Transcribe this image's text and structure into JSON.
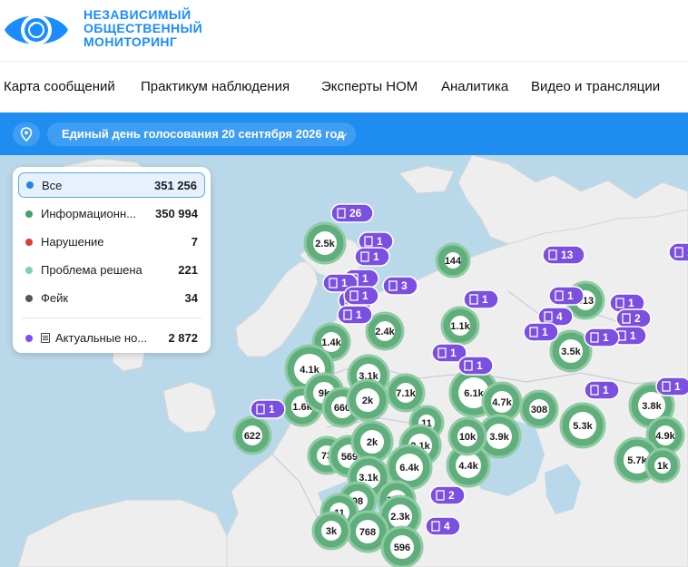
{
  "brand": {
    "line1": "НЕЗАВИСИМЫЙ",
    "line2": "ОБЩЕСТВЕННЫЙ",
    "line3": "МОНИТОРИНГ",
    "logo_icon": "eye-logo"
  },
  "nav": [
    {
      "label": "Карта сообщений"
    },
    {
      "label": "Практикум наблюдения"
    },
    {
      "label": "Эксперты НОМ"
    },
    {
      "label": "Аналитика"
    },
    {
      "label": "Видео и трансляции"
    }
  ],
  "filter": {
    "location_icon": "location-pin-icon",
    "election": "Единый день голосования 20 сентября 2026 год",
    "chevron_icon": "chevron-down-icon"
  },
  "legend": [
    {
      "label": "Все",
      "count": "351 256",
      "color": "#1e88e5",
      "active": true
    },
    {
      "label": "Информационн...",
      "count": "350 994",
      "color": "#43a36b"
    },
    {
      "label": "Нарушение",
      "count": "7",
      "color": "#e53935"
    },
    {
      "label": "Проблема решена",
      "count": "221",
      "color": "#7dd3b0"
    },
    {
      "label": "Фейк",
      "count": "34",
      "color": "#555555"
    },
    {
      "label": "Актуальные но...",
      "count": "2 872",
      "color": "#7c4dff",
      "doc": true
    }
  ],
  "colors": {
    "cluster_green": "#5fae7c",
    "cluster_ring": "#8fcaa3",
    "pill_purple": "#7b4fe0",
    "brand_blue": "#1a8cff",
    "bar_blue": "#1f8cf0"
  },
  "clusters": [
    {
      "label": "2.5k"
    },
    {
      "label": "144"
    },
    {
      "label": "913"
    },
    {
      "label": "1.4k"
    },
    {
      "label": "2.4k"
    },
    {
      "label": "1.1k"
    },
    {
      "label": "3.5k"
    },
    {
      "label": "4.1k"
    },
    {
      "label": "3.1k"
    },
    {
      "label": "1.6k"
    },
    {
      "label": "9k"
    },
    {
      "label": "660"
    },
    {
      "label": "2k"
    },
    {
      "label": "7.1k"
    },
    {
      "label": "6.1k"
    },
    {
      "label": "4.7k"
    },
    {
      "label": "308"
    },
    {
      "label": "5.3k"
    },
    {
      "label": "3.8k"
    },
    {
      "label": "622"
    },
    {
      "label": "11"
    },
    {
      "label": "2.1k"
    },
    {
      "label": "3.9k"
    },
    {
      "label": "4.9k"
    },
    {
      "label": "73"
    },
    {
      "label": "569"
    },
    {
      "label": "2k"
    },
    {
      "label": "3.1k"
    },
    {
      "label": "4.4k"
    },
    {
      "label": "6.4k"
    },
    {
      "label": "10k"
    },
    {
      "label": "5.7k"
    },
    {
      "label": "1k"
    },
    {
      "label": "3.6k"
    },
    {
      "label": "98"
    },
    {
      "label": "11"
    },
    {
      "label": "2.3k"
    },
    {
      "label": "768"
    },
    {
      "label": "596"
    },
    {
      "label": "3k"
    }
  ],
  "pills": [
    {
      "label": "26"
    },
    {
      "label": "1"
    },
    {
      "label": "1"
    },
    {
      "label": "13"
    },
    {
      "label": "1"
    },
    {
      "label": "3"
    },
    {
      "label": "1"
    },
    {
      "label": "3"
    },
    {
      "label": "1"
    },
    {
      "label": "1"
    },
    {
      "label": "1"
    },
    {
      "label": "1"
    },
    {
      "label": "4"
    },
    {
      "label": "2"
    },
    {
      "label": "1"
    },
    {
      "label": "1"
    },
    {
      "label": "1"
    },
    {
      "label": "1"
    },
    {
      "label": "1"
    },
    {
      "label": "1"
    },
    {
      "label": "1"
    },
    {
      "label": "2"
    },
    {
      "label": "4"
    },
    {
      "label": "1"
    },
    {
      "label": "1"
    },
    {
      "label": "1"
    }
  ]
}
